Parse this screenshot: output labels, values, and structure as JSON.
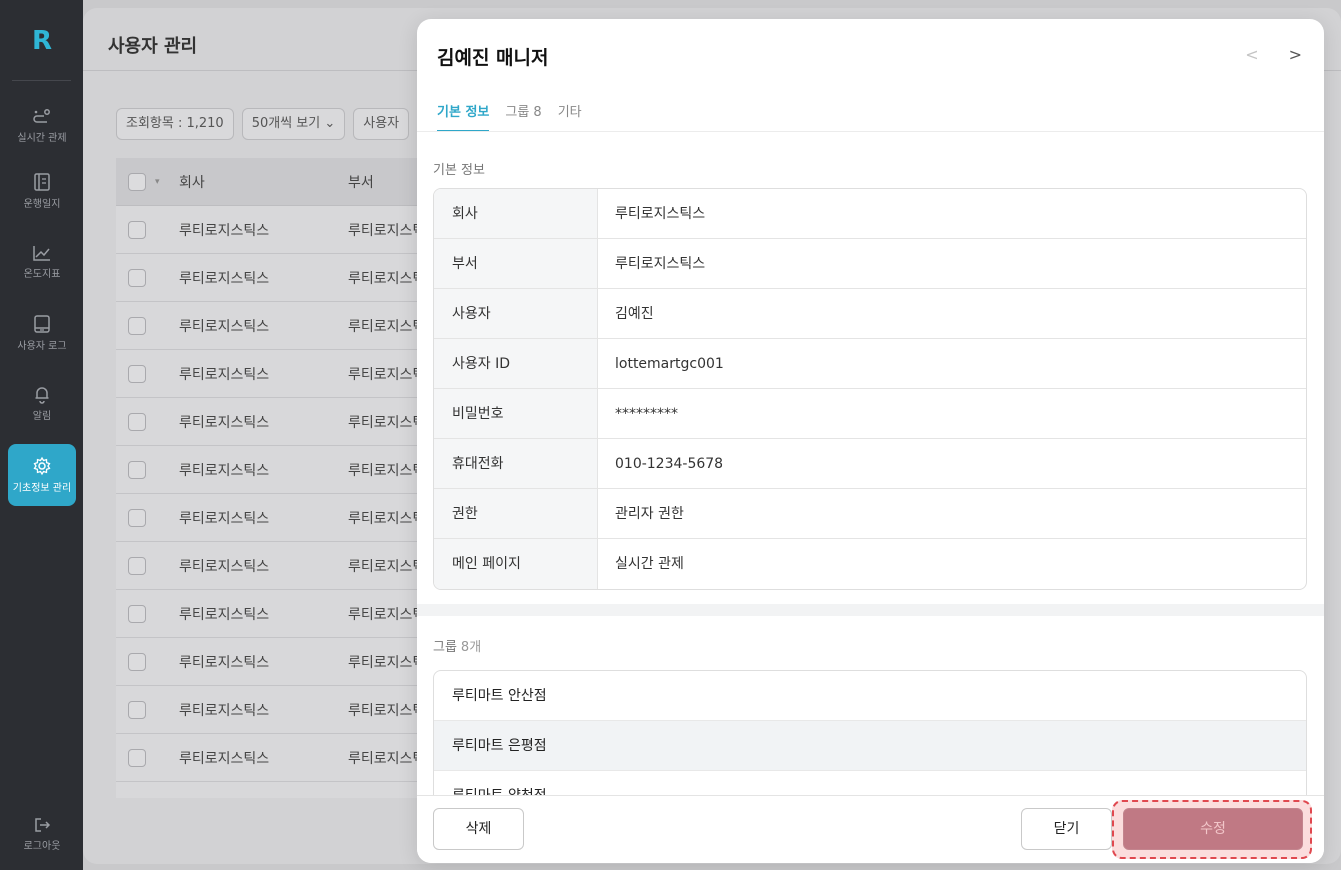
{
  "sidebar": {
    "logo": "R",
    "items": [
      {
        "label": "실시간 관제",
        "icon": "route-icon"
      },
      {
        "label": "운행일지",
        "icon": "logbook-icon"
      },
      {
        "label": "온도지표",
        "icon": "chart-line-icon"
      },
      {
        "label": "사용자 로그",
        "icon": "device-icon"
      },
      {
        "label": "알림",
        "icon": "bell-icon"
      },
      {
        "label": "기초정보 관리",
        "icon": "gear-icon",
        "active": true
      }
    ],
    "logout": {
      "label": "로그아웃",
      "icon": "logout-icon"
    }
  },
  "page": {
    "title": "사용자 관리",
    "toolbar": {
      "count_label": "조회항목 : 1,210",
      "page_size": "50개씩 보기",
      "filter": "사용자"
    },
    "table": {
      "headers": [
        "회사",
        "부서"
      ],
      "rows": [
        [
          "루티로지스틱스",
          "루티로지스틱스"
        ],
        [
          "루티로지스틱스",
          "루티로지스틱스"
        ],
        [
          "루티로지스틱스",
          "루티로지스틱스"
        ],
        [
          "루티로지스틱스",
          "루티로지스틱스"
        ],
        [
          "루티로지스틱스",
          "루티로지스틱스"
        ],
        [
          "루티로지스틱스",
          "루티로지스틱스"
        ],
        [
          "루티로지스틱스",
          "루티로지스틱스"
        ],
        [
          "루티로지스틱스",
          "루티로지스틱스"
        ],
        [
          "루티로지스틱스",
          "루티로지스틱스"
        ],
        [
          "루티로지스틱스",
          "루티로지스틱스"
        ],
        [
          "루티로지스틱스",
          "루티로지스틱스"
        ],
        [
          "루티로지스틱스",
          "루티로지스틱스"
        ]
      ]
    }
  },
  "modal": {
    "title": "김예진 매니저",
    "nav_prev": "<",
    "nav_next": ">",
    "tabs": [
      "기본 정보",
      "그룹 8",
      "기타"
    ],
    "basic_section": "기본 정보",
    "fields": [
      {
        "key": "회사",
        "value": "루티로지스틱스"
      },
      {
        "key": "부서",
        "value": "루티로지스틱스"
      },
      {
        "key": "사용자",
        "value": "김예진"
      },
      {
        "key": "사용자 ID",
        "value": "lottemartgc001"
      },
      {
        "key": "비밀번호",
        "value": "*********"
      },
      {
        "key": "휴대전화",
        "value": "010-1234-5678"
      },
      {
        "key": "권한",
        "value": "관리자 권한"
      },
      {
        "key": "메인 페이지",
        "value": "실시간 관제"
      }
    ],
    "group_section": "그룹",
    "group_count": "8개",
    "groups": [
      "루티마트 안산점",
      "루티마트 은평점",
      "루티마트 양천점"
    ],
    "buttons": {
      "delete": "삭제",
      "close": "닫기",
      "edit": "수정"
    }
  }
}
